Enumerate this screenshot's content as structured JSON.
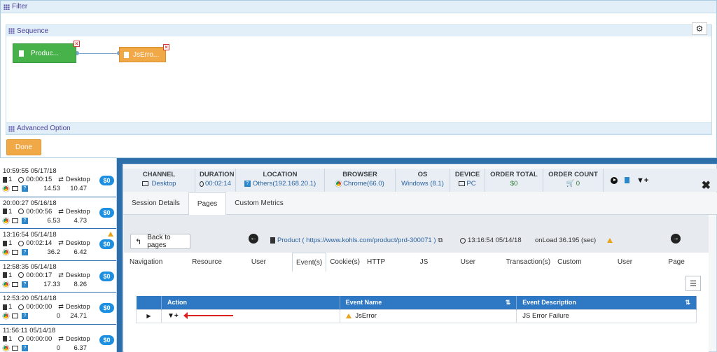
{
  "filter": {
    "title": "Filter",
    "sequence_title": "Sequence",
    "advanced_title": "Advanced Option",
    "done_label": "Done",
    "nodes": [
      {
        "label": "Produc...",
        "color": "#47b249"
      },
      {
        "label": "JsErro...",
        "color": "#f1a846"
      }
    ]
  },
  "sessions": [
    {
      "time": "10:59:55 05/17/18",
      "pages": "1",
      "duration": "00:00:15",
      "device": "Desktop",
      "v1": "14.53",
      "v2": "10.47",
      "cost": "$0",
      "warning": false
    },
    {
      "time": "20:00:27 05/16/18",
      "pages": "1",
      "duration": "00:00:56",
      "device": "Desktop",
      "v1": "6.53",
      "v2": "4.73",
      "cost": "$0",
      "warning": false
    },
    {
      "time": "13:16:54 05/14/18",
      "pages": "1",
      "duration": "00:02:14",
      "device": "Desktop",
      "v1": "36.2",
      "v2": "6.42",
      "cost": "$0",
      "warning": true
    },
    {
      "time": "12:58:35 05/14/18",
      "pages": "1",
      "duration": "00:00:17",
      "device": "Desktop",
      "v1": "17.33",
      "v2": "8.26",
      "cost": "$0",
      "warning": false
    },
    {
      "time": "12:53:20 05/14/18",
      "pages": "1",
      "duration": "00:00:00",
      "device": "Desktop",
      "v1": "0",
      "v2": "24.71",
      "cost": "$0",
      "warning": false
    },
    {
      "time": "11:56:11 05/14/18",
      "pages": "1",
      "duration": "00:00:00",
      "device": "Desktop",
      "v1": "0",
      "v2": "6.37",
      "cost": "$0",
      "warning": false
    }
  ],
  "detail": {
    "stats": [
      {
        "label": "CHANNEL",
        "value": "Desktop"
      },
      {
        "label": "DURATION",
        "value": "00:02:14"
      },
      {
        "label": "LOCATION",
        "value": "Others(192.168.20.1)"
      },
      {
        "label": "BROWSER",
        "value": "Chrome(66.0)"
      },
      {
        "label": "OS",
        "value": "Windows (8.1)"
      },
      {
        "label": "DEVICE",
        "value": "PC"
      },
      {
        "label": "ORDER TOTAL",
        "value": "$0"
      },
      {
        "label": "ORDER COUNT",
        "value": "0"
      }
    ],
    "tabs": [
      "Session Details",
      "Pages",
      "Custom Metrics"
    ],
    "back_label": "Back to pages",
    "page_url": "Product ( https://www.kohls.com/product/prd-300071 )",
    "page_time": "13:16:54 05/14/18",
    "onload": "onLoad 36.195 (sec)",
    "event_tabs": [
      "Navigation Timing",
      "Resource Timing",
      "User Timing",
      "Event(s)",
      "Cookie(s)",
      "HTTP Request",
      "JS Error(s)",
      "User Activity",
      "Transaction(s)",
      "Custom Metric(s)",
      "User Action(s)",
      "Page Dump"
    ],
    "table": {
      "headers": [
        "Action",
        "Event Name",
        "Event Description"
      ],
      "rows": [
        {
          "event_name": "JsError",
          "description": "JS Error Failure"
        }
      ]
    }
  }
}
